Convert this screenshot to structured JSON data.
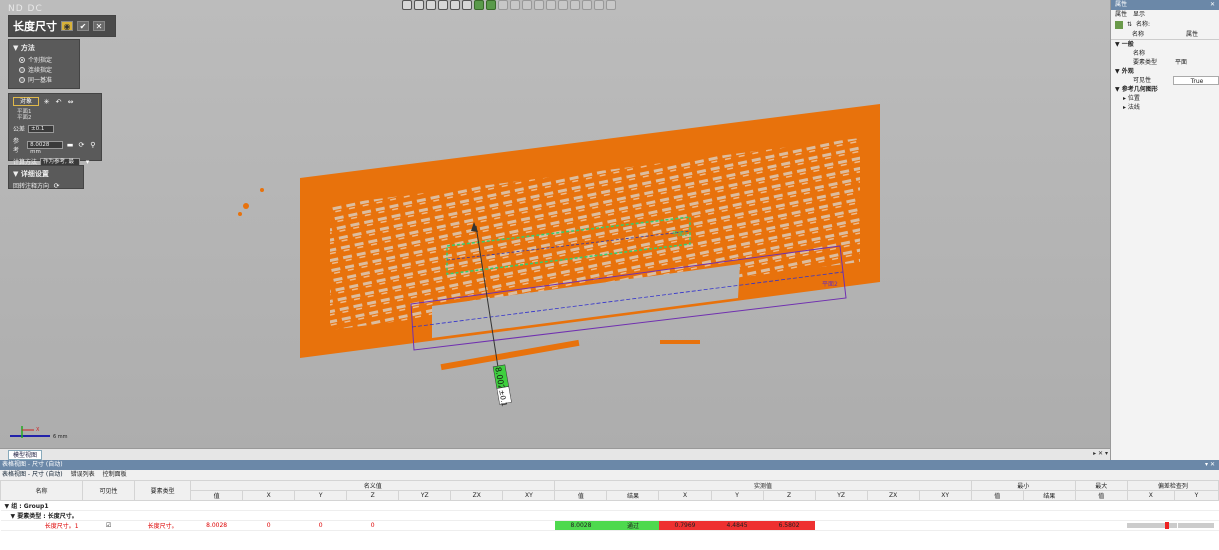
{
  "viewport": {
    "corner_label": "ND DC",
    "dim_value": "8.0028",
    "dim_tol": "±0.1",
    "plane1_label": "平面1",
    "plane2_label": "平面2",
    "scale_label": "6 mm",
    "axis_x": "X"
  },
  "tool_panel": {
    "title": "长度尺寸",
    "method": {
      "heading": "▼ 方法",
      "options": [
        "个别指定",
        "连续指定",
        "同一基准"
      ]
    },
    "object": {
      "button_label": "对象",
      "check1": "平面1",
      "check2": "平面2",
      "tolerance_label": "公差",
      "tolerance_value": "±0.1",
      "reference_label": "参考",
      "reference_value": "8.0028 mm",
      "calc_label": "计算方法",
      "calc_value": "作为参考, 最优匹配"
    },
    "detail": {
      "heading": "▼ 详细设置",
      "rotate_label": "回转注释方向"
    }
  },
  "model_tab": {
    "label": "模型视图"
  },
  "properties": {
    "header": "属性",
    "tab_props": "属性",
    "tab_display": "显示",
    "name_label": "名称:",
    "col_name": "名称",
    "col_prop": "属性",
    "rows": [
      {
        "k": "▼ 一般",
        "v": "",
        "type": "cat"
      },
      {
        "k": "名称",
        "v": "",
        "type": "i2"
      },
      {
        "k": "要素类型",
        "v": "平面",
        "type": "i2"
      },
      {
        "k": "▼ 外观",
        "v": "",
        "type": "cat"
      },
      {
        "k": "可见性",
        "v": "True",
        "type": "i2box"
      },
      {
        "k": "▼ 参考几何图形",
        "v": "",
        "type": "cat"
      },
      {
        "k": "▸ 位置",
        "v": "",
        "type": "i1"
      },
      {
        "k": "▸ 法线",
        "v": "",
        "type": "i1"
      }
    ]
  },
  "bottom": {
    "title": "表格视图 - 尺寸 (自动)",
    "tabs": [
      "表格视图 - 尺寸 (自动)",
      "错误列表",
      "控制面板"
    ],
    "col_groups": {
      "name": "名称",
      "visible": "可见性",
      "type": "要素类型",
      "nominal": "名义值",
      "measured": "实测值",
      "min": "最小",
      "max": "最大",
      "deviation": "偏差检查列"
    },
    "sub_nominal": [
      "值",
      "X",
      "Y",
      "Z",
      "YZ",
      "ZX",
      "XY"
    ],
    "sub_measured": [
      "值",
      "结果",
      "X",
      "Y",
      "Z",
      "YZ",
      "ZX",
      "XY"
    ],
    "sub_min": [
      "值",
      "结果"
    ],
    "sub_max": [
      "值"
    ],
    "sub_dev": [
      "X",
      "Y"
    ],
    "group_row": "▼ 组 : Group1",
    "type_row": "▼ 要素类型 : 长度尺寸。",
    "data_row": {
      "name": "长度尺寸。1",
      "type": "长度尺寸。",
      "nominal_value": "8.0028",
      "nominal_x": "0",
      "nominal_y": "0",
      "nominal_z": "0",
      "measured_value": "8.0028",
      "result": "通过",
      "measured_x": "0.7969",
      "measured_y": "4.4845",
      "measured_z": "6.5802"
    }
  }
}
